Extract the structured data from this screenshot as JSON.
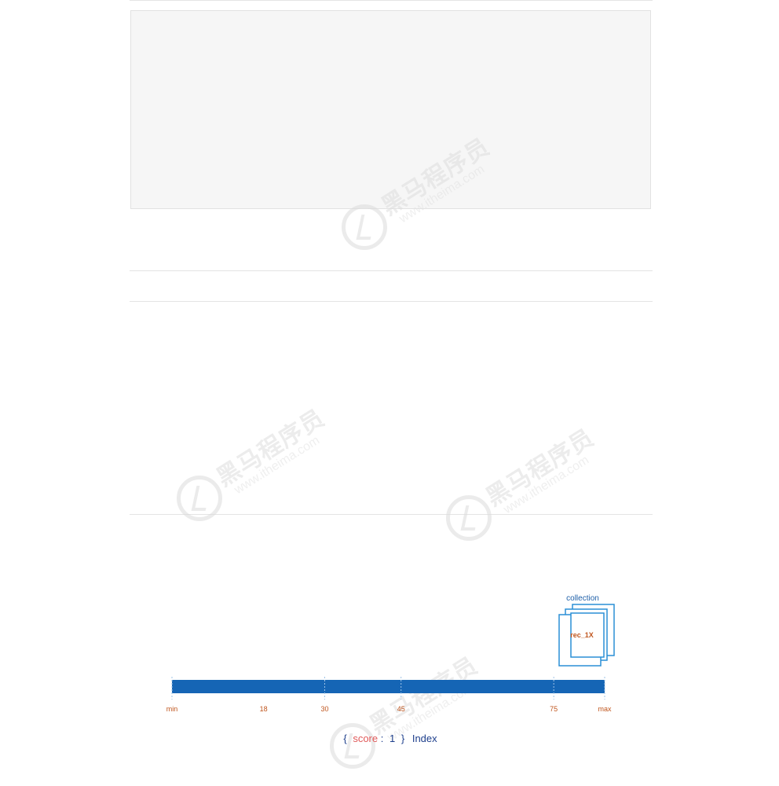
{
  "watermark": {
    "brand": "黑马程序员",
    "url": "www.itheima.com"
  },
  "diagram": {
    "collection_label": "collection",
    "doc_label": "rec_1X",
    "bar_color": "#1565b5",
    "frame_color": "#2a8fd6",
    "tick_color": "#c0561e",
    "ticks": [
      {
        "label": "min",
        "value": 0,
        "marker": true
      },
      {
        "label": "18",
        "value": 18,
        "marker": false
      },
      {
        "label": "30",
        "value": 30,
        "marker": true
      },
      {
        "label": "45",
        "value": 45,
        "marker": true
      },
      {
        "label": "75",
        "value": 75,
        "marker": true
      },
      {
        "label": "max",
        "value": 85,
        "marker": true
      }
    ],
    "axis": {
      "min": 0,
      "max": 85
    },
    "caption": {
      "open": "{",
      "field": "score",
      "colon": ":",
      "value": "1",
      "close": "}",
      "suffix": "Index"
    }
  }
}
